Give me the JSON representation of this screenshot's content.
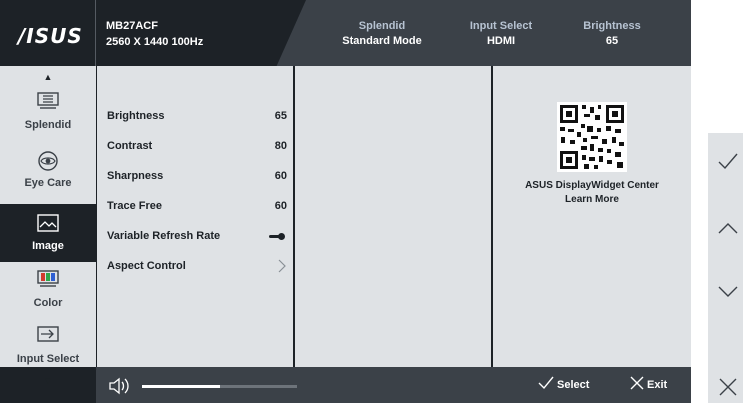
{
  "brand": {
    "logo_text": "/ISUS"
  },
  "monitor": {
    "model": "MB27ACF",
    "resolution": "2560 X 1440 100Hz"
  },
  "header_stats": [
    {
      "label": "Splendid",
      "value": "Standard Mode"
    },
    {
      "label": "Input Select",
      "value": "HDMI"
    },
    {
      "label": "Brightness",
      "value": "65"
    }
  ],
  "sidebar": {
    "items": [
      {
        "label": "Splendid",
        "icon": "splendid-icon",
        "active": false
      },
      {
        "label": "Eye Care",
        "icon": "eye-care-icon",
        "active": false
      },
      {
        "label": "Image",
        "icon": "image-icon",
        "active": true
      },
      {
        "label": "Color",
        "icon": "color-icon",
        "active": false
      },
      {
        "label": "Input Select",
        "icon": "input-select-icon",
        "active": false
      }
    ]
  },
  "image_settings": [
    {
      "name": "Brightness",
      "value": "65"
    },
    {
      "name": "Contrast",
      "value": "80"
    },
    {
      "name": "Sharpness",
      "value": "60"
    },
    {
      "name": "Trace Free",
      "value": "60"
    },
    {
      "name": "Variable Refresh Rate",
      "control": "toggle",
      "toggle_on": true
    },
    {
      "name": "Aspect Control",
      "control": "submenu-chevron"
    }
  ],
  "widget": {
    "title": "ASUS DisplayWidget Center",
    "link": "Learn More"
  },
  "footer": {
    "volume_level": 0.5,
    "select_label": "Select",
    "exit_label": "Exit"
  },
  "keys": [
    "check-icon",
    "chevron-up-icon",
    "chevron-down-icon",
    "close-icon"
  ],
  "colors": {
    "osd_dark": "#1d2227",
    "header": "#3b4148",
    "panel": "#dfe2e5",
    "header_label": "#b7c3d2"
  }
}
